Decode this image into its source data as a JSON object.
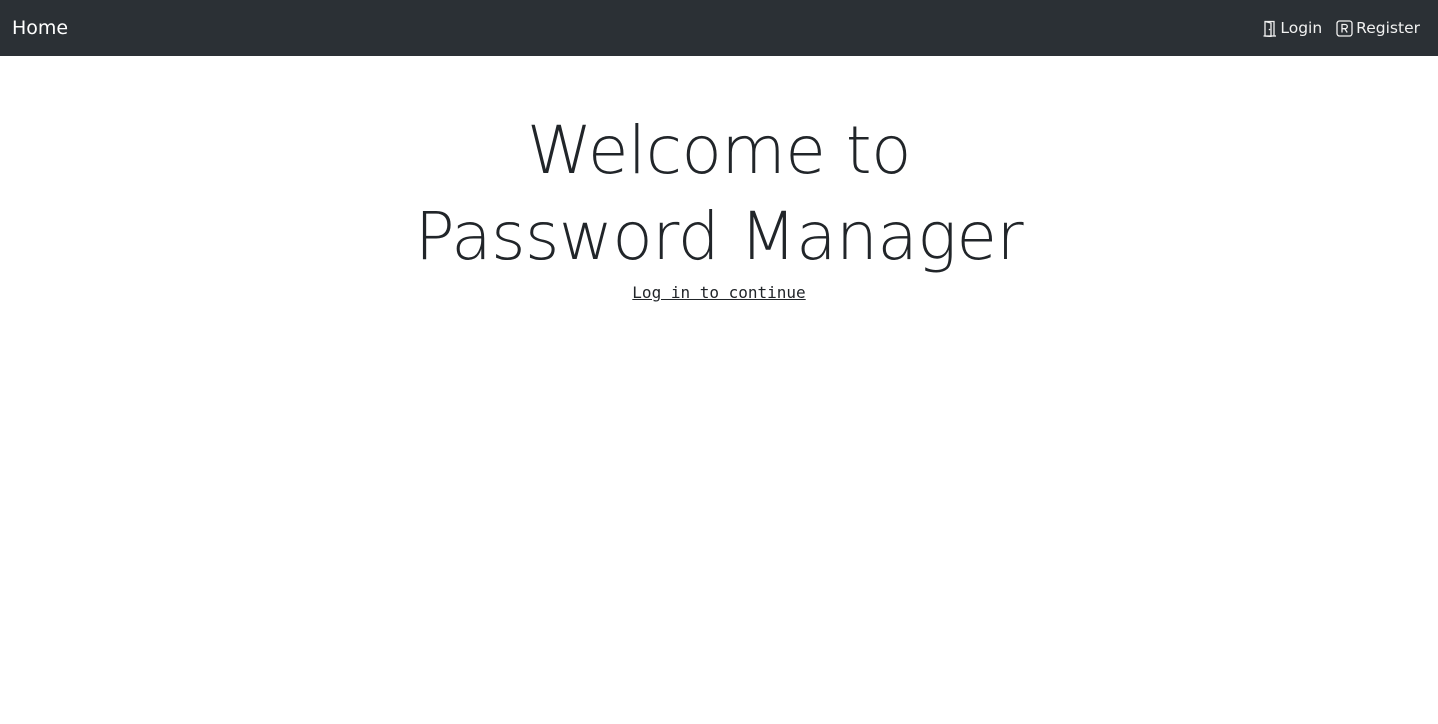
{
  "navbar": {
    "brand": "Home",
    "links": [
      {
        "label": "Login",
        "icon": "door-icon"
      },
      {
        "label": "Register",
        "icon": "r-badge-icon"
      }
    ],
    "background": "#2b3035"
  },
  "hero": {
    "title_line1": "Welcome to",
    "title_line2": "Password Manager",
    "cta": "Log in to continue"
  }
}
